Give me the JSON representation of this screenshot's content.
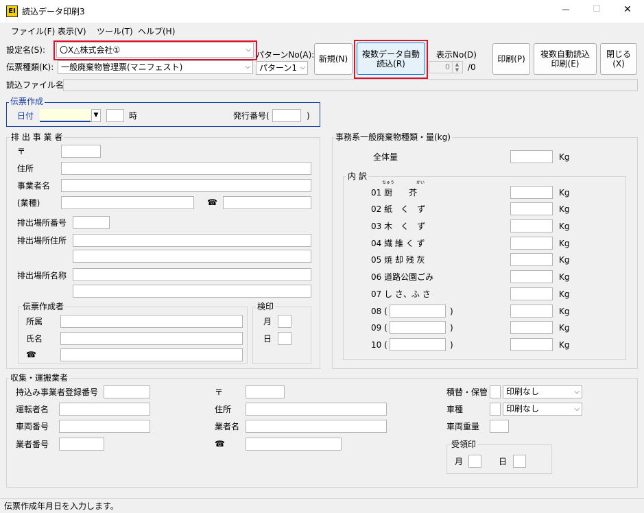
{
  "window": {
    "title": "読込データ印刷3",
    "app_icon": "EI",
    "minimize": "—",
    "maximize": "☐",
    "close": "✕"
  },
  "menu": [
    {
      "label": "ファイル(F)"
    },
    {
      "label": "表示(V)"
    },
    {
      "label": "ツール(T)"
    },
    {
      "label": "ヘルプ(H)"
    }
  ],
  "toolbar": {
    "setting_label": "設定名(S):",
    "setting_value": "〇X△株式会社①",
    "slip_type_label": "伝票種類(K):",
    "slip_type_value": "一般廃棄物管理票(マニフェスト)",
    "pattern_label": "パターンNo(A):",
    "pattern_value": "パターン1",
    "new_button": "新規(N)",
    "multi_auto_read_button": "複数データ自動\n読込(R)",
    "display_no_label": "表示No(D)",
    "display_no_value": "0",
    "display_no_total": "/0",
    "print_button": "印刷(P)",
    "multi_auto_read_print_button": "複数自動読込\n印刷(E)",
    "close_button": "閉じる(X)",
    "read_file_label": "読込ファイル名"
  },
  "slip_creation": {
    "title": "伝票作成",
    "date_label": "日付",
    "hour_label": "時",
    "issue_no_label": "発行番号(",
    "issue_no_close": ")"
  },
  "discharger": {
    "title": "排 出 事 業 者",
    "postal_label": "〒",
    "address_label": "住所",
    "business_name_label": "事業者名",
    "industry_label": "(業種)",
    "phone_icon": "☎",
    "site_no_label": "排出場所番号",
    "site_address_label": "排出場所住所",
    "site_name_label": "排出場所名称",
    "creator": {
      "title": "伝票作成者",
      "dept_label": "所属",
      "name_label": "氏名",
      "phone_icon": "☎"
    },
    "inspection": {
      "title": "検印",
      "month_label": "月",
      "day_label": "日"
    }
  },
  "waste": {
    "title": "事務系一般廃棄物種類・量(kg)",
    "total_label": "全体量",
    "unit": "Kg",
    "breakdown_title": "内 訳",
    "items": [
      {
        "label": "01 厨　　芥",
        "ruby1": "ちゅう",
        "ruby2": "かい",
        "unit": "Kg"
      },
      {
        "label": "02 紙　く　ず",
        "unit": "Kg"
      },
      {
        "label": "03 木　く　ず",
        "unit": "Kg"
      },
      {
        "label": "04 繊 維 く ず",
        "unit": "Kg"
      },
      {
        "label": "05 焼 却 残 灰",
        "unit": "Kg"
      },
      {
        "label": "06 道路公園ごみ",
        "unit": "Kg"
      },
      {
        "label": "07 し さ、ふ さ",
        "unit": "Kg"
      },
      {
        "label": "08 (",
        "close": ")",
        "unit": "Kg"
      },
      {
        "label": "09 (",
        "close": ")",
        "unit": "Kg"
      },
      {
        "label": "10 (",
        "close": ")",
        "unit": "Kg"
      }
    ]
  },
  "collector": {
    "title": "収集・運搬業者",
    "reg_no_label": "持込み事業者登録番号",
    "driver_label": "運転者名",
    "vehicle_no_label": "車両番号",
    "business_no_label": "業者番号",
    "postal_label": "〒",
    "address_label": "住所",
    "company_label": "業者名",
    "phone_icon": "☎",
    "transship_label": "積替・保管",
    "transship_value": "印刷なし",
    "vehicle_type_label": "車種",
    "vehicle_type_value": "印刷なし",
    "vehicle_weight_label": "車両重量",
    "receipt": {
      "title": "受領印",
      "month_label": "月",
      "day_label": "日"
    }
  },
  "status_bar": {
    "text": "伝票作成年月日を入力します。"
  },
  "colors": {
    "highlight": "#e0102a",
    "focus_group": "#1a3fa8",
    "selected_input": "#ffffe1"
  }
}
